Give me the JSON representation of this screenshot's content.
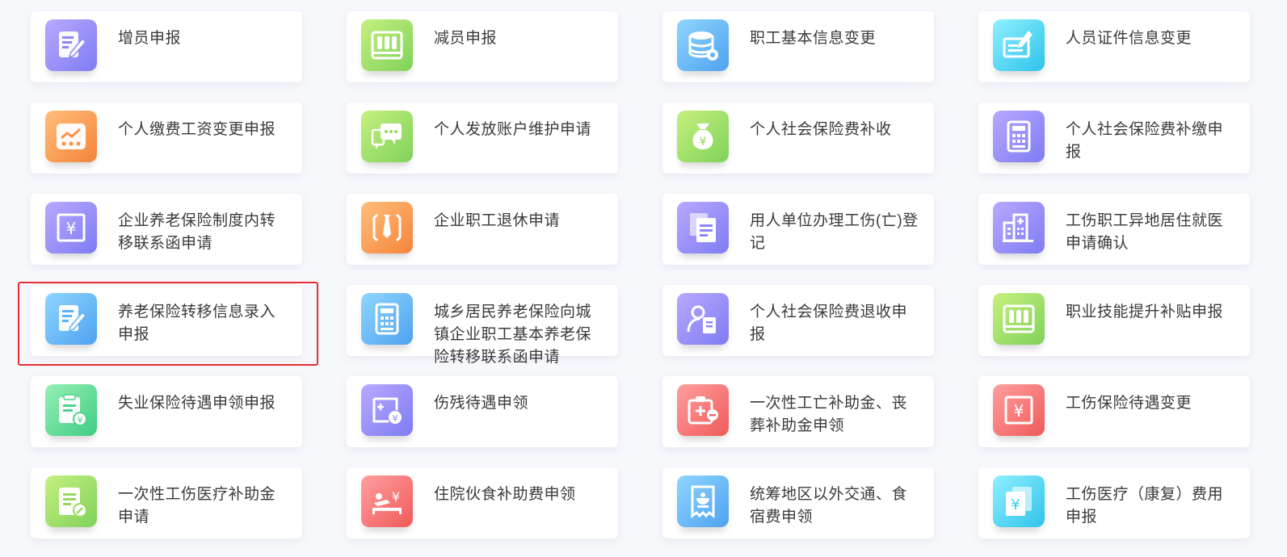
{
  "services": [
    {
      "label": "增员申报",
      "icon": "document-pen-icon",
      "color": "#8e86f6"
    },
    {
      "label": "减员申报",
      "icon": "binders-icon",
      "color": "#9ddc66"
    },
    {
      "label": "职工基本信息变更",
      "icon": "database-icon",
      "color": "#5fb2f4"
    },
    {
      "label": "人员证件信息变更",
      "icon": "certificate-pen-icon",
      "color": "#38cdee"
    },
    {
      "label": "个人缴费工资变更申报",
      "icon": "trend-chart-icon",
      "color": "#f8944a"
    },
    {
      "label": "个人发放账户维护申请",
      "icon": "chat-bubbles-icon",
      "color": "#94d95f"
    },
    {
      "label": "个人社会保险费补收",
      "icon": "money-bag-icon",
      "color": "#92d65e"
    },
    {
      "label": "个人社会保险费补缴申报",
      "icon": "calculator-icon",
      "color": "#8e86f6"
    },
    {
      "label": "企业养老保险制度内转移联系函申请",
      "icon": "yuan-frame-icon",
      "color": "#8e86f6"
    },
    {
      "label": "企业职工退休申请",
      "icon": "briefcase-tie-icon",
      "color": "#f8944a"
    },
    {
      "label": "用人单位办理工伤(亡)登记",
      "icon": "documents-icon",
      "color": "#8e86f6"
    },
    {
      "label": "工伤职工异地居住就医申请确认",
      "icon": "hospital-building-icon",
      "color": "#8e86f6"
    },
    {
      "label": "养老保险转移信息录入申报",
      "icon": "document-pen-icon",
      "color": "#5fb2f4"
    },
    {
      "label": "城乡居民养老保险向城镇企业职工基本养老保险转移联系函申请",
      "icon": "calculator-icon",
      "color": "#5fb2f4"
    },
    {
      "label": "个人社会保险费退收申报",
      "icon": "person-document-icon",
      "color": "#8e86f6"
    },
    {
      "label": "职业技能提升补贴申报",
      "icon": "binders-icon",
      "color": "#9ddc66"
    },
    {
      "label": "失业保险待遇申领申报",
      "icon": "clipboard-yuan-icon",
      "color": "#4bd28c"
    },
    {
      "label": "伤残待遇申领",
      "icon": "medical-card-icon",
      "color": "#8e86f6"
    },
    {
      "label": "一次性工亡补助金、丧葬补助金申领",
      "icon": "medical-kit-icon",
      "color": "#f26a6a"
    },
    {
      "label": "工伤保险待遇变更",
      "icon": "yuan-frame-icon",
      "color": "#f26a6a"
    },
    {
      "label": "一次性工伤医疗补助金申请",
      "icon": "document-edit-icon",
      "color": "#94d95f"
    },
    {
      "label": "住院伙食补助费申领",
      "icon": "patient-bed-icon",
      "color": "#f26a6a"
    },
    {
      "label": "统筹地区以外交通、食宿费申领",
      "icon": "receipt-bowl-icon",
      "color": "#5fb2f4"
    },
    {
      "label": "工伤医疗（康复）费用申报",
      "icon": "yuan-cards-icon",
      "color": "#38cdee"
    }
  ]
}
